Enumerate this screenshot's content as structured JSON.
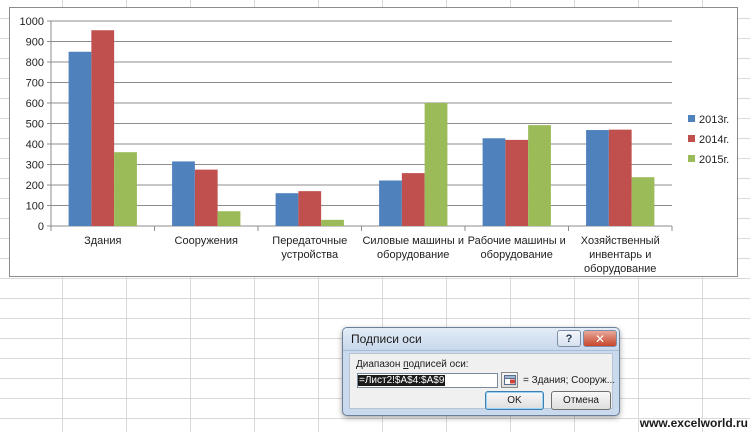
{
  "chart_data": {
    "type": "bar",
    "categories": [
      [
        "Здания"
      ],
      [
        "Сооружения"
      ],
      [
        "Передаточные",
        "устройства"
      ],
      [
        "Силовые машины и",
        "оборудование"
      ],
      [
        "Рабочие машины и",
        "оборудование"
      ],
      [
        "Хозяйственный",
        "инвентарь и",
        "оборудование"
      ]
    ],
    "series": [
      {
        "name": "2013г.",
        "color": "#4f81bd",
        "values": [
          850,
          315,
          160,
          222,
          428,
          468
        ]
      },
      {
        "name": "2014г.",
        "color": "#c0504d",
        "values": [
          955,
          275,
          170,
          258,
          420,
          470
        ]
      },
      {
        "name": "2015г.",
        "color": "#9bbb59",
        "values": [
          360,
          72,
          30,
          600,
          492,
          238
        ]
      }
    ],
    "ylim": [
      0,
      1000
    ],
    "yticks": [
      "0",
      "100",
      "200",
      "300",
      "400",
      "500",
      "600",
      "700",
      "800",
      "900",
      "1000"
    ],
    "grid": true,
    "legend_position": "right"
  },
  "dialog": {
    "title": "Подписи оси",
    "help_icon_label": "?",
    "close_icon_label": "✕",
    "range_label_prefix": "Диапазон ",
    "range_label_accel": "п",
    "range_label_suffix": "одписей оси:",
    "range_value": "=Лист2!$A$4:$A$9",
    "range_preview": "= Здания; Сооруж...",
    "ok_label": "OK",
    "cancel_label": "Отмена"
  },
  "watermark": "www.excelworld.ru"
}
